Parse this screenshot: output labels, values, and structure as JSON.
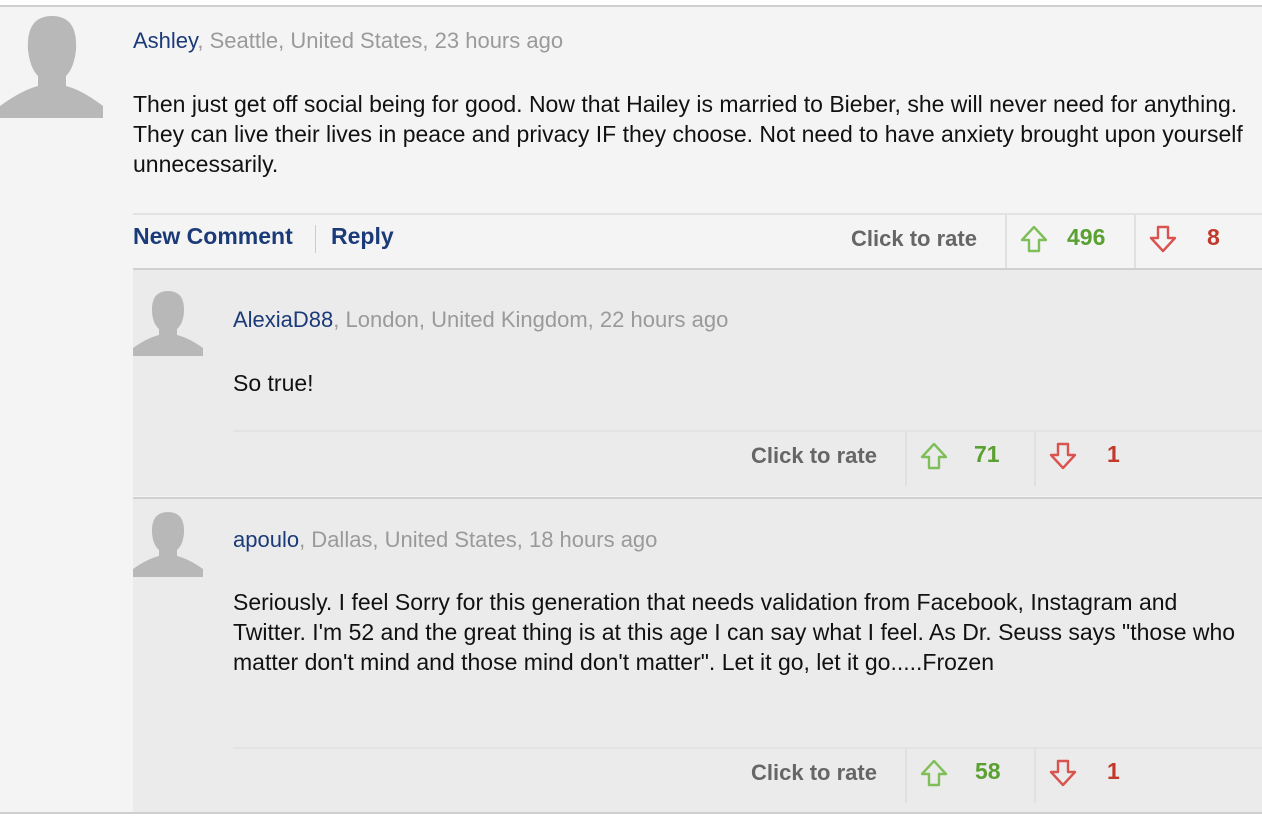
{
  "comments": [
    {
      "author": "Ashley",
      "location": ", Seattle, United States, 23 hours ago",
      "text": "Then just get off social being for good. Now that Hailey is married to Bieber, she will never need for anything. They can live their lives in peace and privacy IF they choose. Not need to have anxiety brought upon yourself unnecessarily.",
      "actions": {
        "new_comment": "New Comment",
        "reply": "Reply"
      },
      "rate_label": "Click to rate",
      "upvotes": "496",
      "downvotes": "8"
    }
  ],
  "replies": [
    {
      "author": "AlexiaD88",
      "location": ", London, United Kingdom, 22 hours ago",
      "text": "So true!",
      "rate_label": "Click to rate",
      "upvotes": "71",
      "downvotes": "1"
    },
    {
      "author": "apoulo",
      "location": ", Dallas, United States, 18 hours ago",
      "text": "Seriously. I feel Sorry for this generation that needs validation from Facebook, Instagram and Twitter. I'm 52 and the great thing is at this age I can say what I feel. As Dr. Seuss says \"those who matter don't mind and those mind don't matter\". Let it go, let it go.....Frozen",
      "rate_label": "Click to rate",
      "upvotes": "58",
      "downvotes": "1"
    }
  ],
  "colors": {
    "author": "#1b3a78",
    "upvote": "#5aa032",
    "downvote": "#c0392b",
    "meta": "#9a9a9a"
  },
  "icons": {
    "avatar": "default-avatar-icon",
    "up": "thumbs-up-arrow-icon",
    "down": "thumbs-down-arrow-icon"
  }
}
